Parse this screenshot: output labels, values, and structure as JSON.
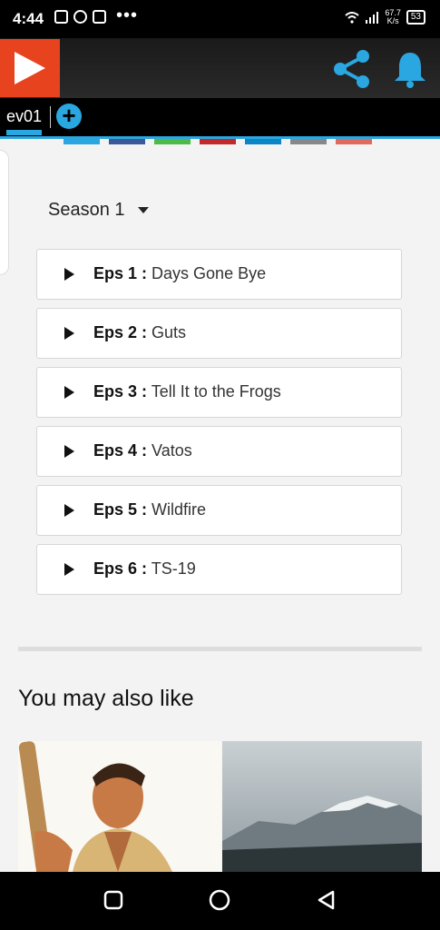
{
  "status_bar": {
    "time": "4:44",
    "more_icon": "•••",
    "net_speed_value": "67.7",
    "net_speed_unit": "K/s",
    "battery": "53",
    "icons": [
      "news-icon",
      "chat-icon",
      "gamepad-icon",
      "wifi-icon",
      "signal-icon",
      "battery-icon"
    ]
  },
  "app_bar": {
    "logo_icon": "play-logo-icon",
    "share_icon": "share-icon",
    "bell_icon": "bell-icon"
  },
  "tabs": {
    "items": [
      {
        "label": "ev01"
      }
    ],
    "add_icon": "+"
  },
  "share_colors": [
    "#2aa7e0",
    "#3b5998",
    "#4cbb47",
    "#c4282a",
    "#0a86c8",
    "#888888",
    "#e36a5a"
  ],
  "season": {
    "label": "Season 1"
  },
  "episodes": [
    {
      "prefix": "Eps 1 :",
      "title": " Days Gone Bye"
    },
    {
      "prefix": "Eps 2 :",
      "title": " Guts"
    },
    {
      "prefix": "Eps 3 :",
      "title": " Tell It to the Frogs"
    },
    {
      "prefix": "Eps 4 :",
      "title": " Vatos"
    },
    {
      "prefix": "Eps 5 :",
      "title": " Wildfire"
    },
    {
      "prefix": "Eps 6 :",
      "title": " TS-19"
    }
  ],
  "recommendations": {
    "heading": "You may also like"
  },
  "colors": {
    "accent": "#2aa7e0",
    "brand": "#e8431f"
  }
}
